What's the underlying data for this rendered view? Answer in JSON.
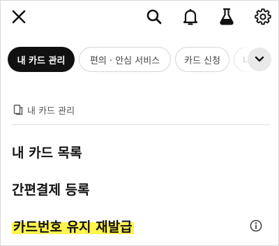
{
  "header": {
    "close_icon": "close-icon",
    "actions": [
      "search-icon",
      "bell-icon",
      "flask-icon",
      "gear-icon"
    ]
  },
  "chips": [
    {
      "label": "내 카드 관리",
      "active": true
    },
    {
      "label": "편의 · 안심 서비스",
      "active": false
    },
    {
      "label": "카드 신청",
      "active": false
    },
    {
      "label": "나",
      "active": false
    }
  ],
  "chip_more_icon": "chevron-down-icon",
  "section": {
    "label": "내 카드 관리",
    "icon": "card-icon"
  },
  "menu": [
    {
      "label": "내 카드 목록"
    },
    {
      "label": "간편결제 등록"
    },
    {
      "label": "카드번호 유지 재발급",
      "highlighted": true,
      "info_icon": "info-icon"
    }
  ],
  "colors": {
    "active_chip": "#111111",
    "highlight": "#fff34d",
    "divider": "#dcdcdc"
  }
}
